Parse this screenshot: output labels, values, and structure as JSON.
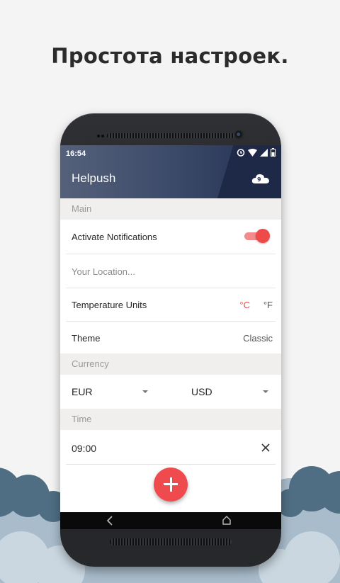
{
  "headline": "Простота настроек.",
  "status_bar": {
    "time": "16:54",
    "icons": [
      "alarm-icon",
      "wifi-icon",
      "signal-icon",
      "battery-icon"
    ]
  },
  "app_bar": {
    "title": "Helpush",
    "action_icon": "weather-cloud-icon"
  },
  "sections": {
    "main": "Main",
    "currency": "Currency",
    "time": "Time"
  },
  "settings": {
    "notifications_label": "Activate Notifications",
    "notifications_enabled": true,
    "location_placeholder": "Your Location...",
    "temperature_label": "Temperature Units",
    "temperature_celsius": "°C",
    "temperature_fahrenheit": "°F",
    "temperature_selected": "°C",
    "theme_label": "Theme",
    "theme_value": "Classic",
    "currency_from": "EUR",
    "currency_to": "USD",
    "time_value": "09:00"
  },
  "colors": {
    "accent": "#ef4a4a",
    "app_bar": "#3a4868",
    "section_bg": "#f1efee"
  },
  "nav": {
    "back_icon": "back-icon",
    "home_icon": "home-icon"
  }
}
